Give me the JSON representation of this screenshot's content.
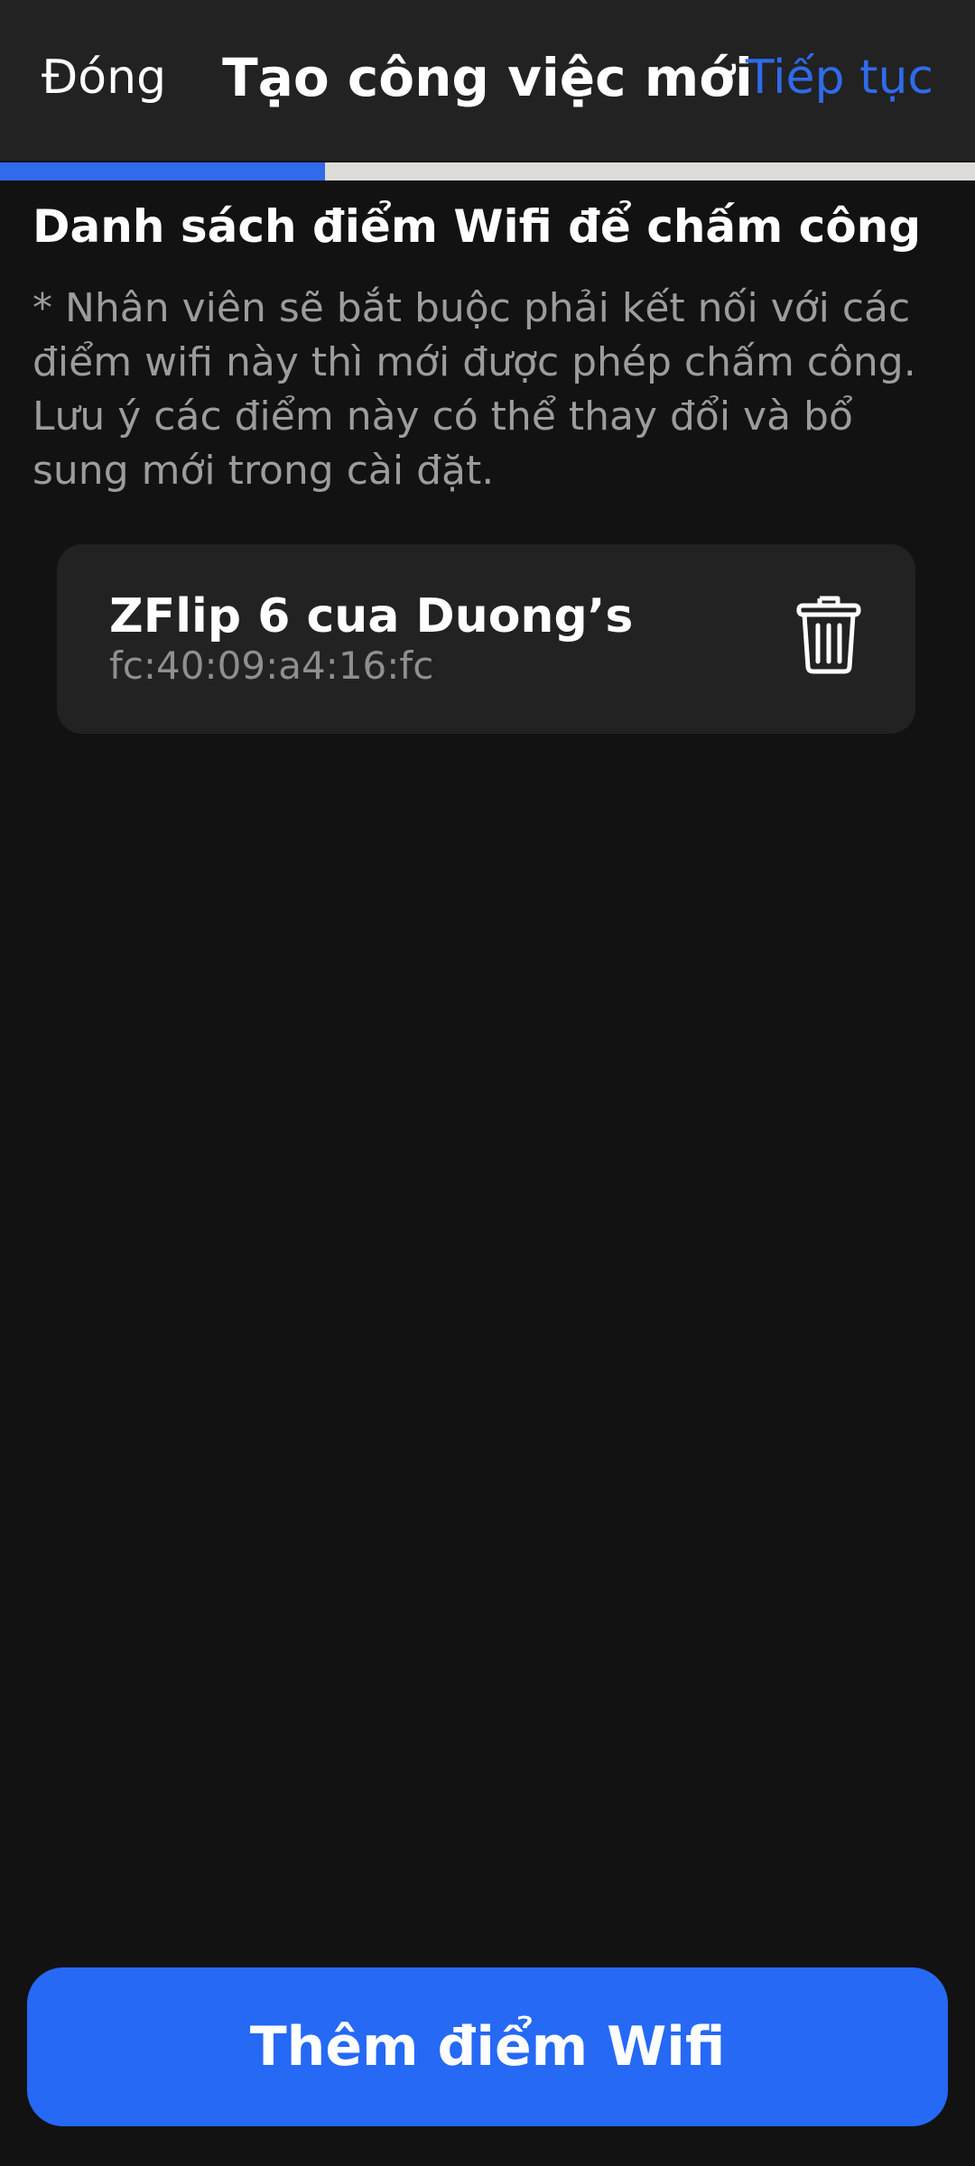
{
  "header": {
    "close_label": "Đóng",
    "title": "Tạo công việc mới",
    "continue_label": "Tiếp tục"
  },
  "progress": {
    "fraction": 0.333
  },
  "section": {
    "title": "Danh sách điểm Wifi để chấm công",
    "description": "* Nhân viên sẽ bắt buộc phải kết nối với các điểm wifi này thì mới được phép chấm công. Lưu ý các điểm này có thể thay đổi và bổ sung mới trong cài đặt."
  },
  "wifi_list": [
    {
      "name": "ZFlip 6 cua Duong’s",
      "mac": "fc:40:09:a4:16:fc",
      "delete_icon": "trash-icon"
    }
  ],
  "add_button": {
    "label": "Thêm điểm Wifi"
  },
  "colors": {
    "accent": "#2569f5",
    "link": "#2f6bea",
    "background": "#121212",
    "surface": "#222222",
    "muted_text": "#9c9c9c"
  }
}
